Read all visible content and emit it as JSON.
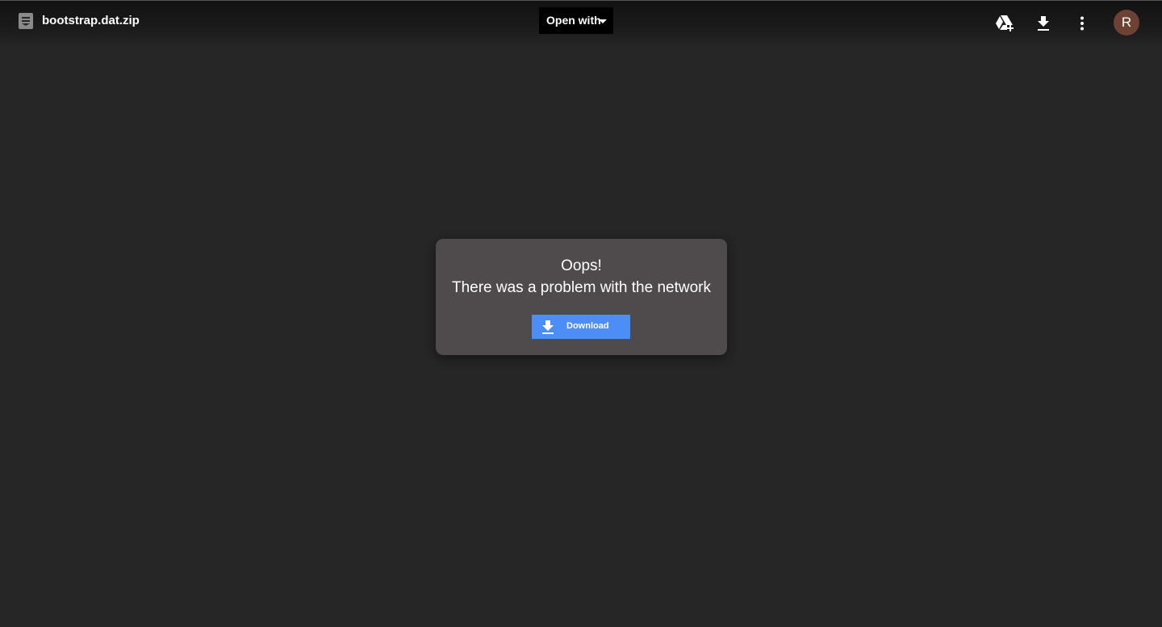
{
  "header": {
    "file_icon": "document-file-icon",
    "file_name": "bootstrap.dat.zip",
    "open_with_label": "Open with",
    "actions": [
      {
        "icon": "add-to-drive-icon"
      },
      {
        "icon": "download-icon"
      },
      {
        "icon": "more-vert-icon"
      }
    ],
    "avatar_initial": "R",
    "avatar_color": "#6d4234"
  },
  "error": {
    "title": "Oops!",
    "message": "There was a problem with the network",
    "download_label": "Download",
    "download_color": "#4c8df6"
  }
}
